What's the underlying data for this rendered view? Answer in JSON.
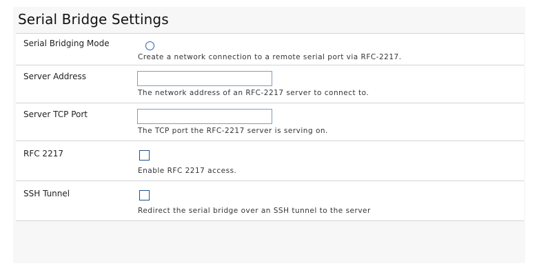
{
  "panel": {
    "title": "Serial Bridge Settings"
  },
  "rows": [
    {
      "label": "Serial Bridging Mode",
      "control": "radio",
      "checked": false,
      "help": "Create a network connection to a remote serial port via RFC-2217."
    },
    {
      "label": "Server Address",
      "control": "text",
      "value": "",
      "help": "The network address of an RFC-2217 server to connect to."
    },
    {
      "label": "Server TCP Port",
      "control": "text",
      "value": "",
      "help": "The TCP port the RFC-2217 server is serving on."
    },
    {
      "label": "RFC 2217",
      "control": "checkbox",
      "checked": false,
      "help": "Enable RFC 2217 access."
    },
    {
      "label": "SSH Tunnel",
      "control": "checkbox",
      "checked": false,
      "help": "Redirect the serial bridge over an SSH tunnel to the server"
    }
  ],
  "colors": {
    "panel_background": "#f7f7f7",
    "row_border": "#d3d3d3",
    "radio_border": "#2e5ea8",
    "checkbox_border": "#1c4f8f",
    "input_border": "#7f9db9"
  }
}
